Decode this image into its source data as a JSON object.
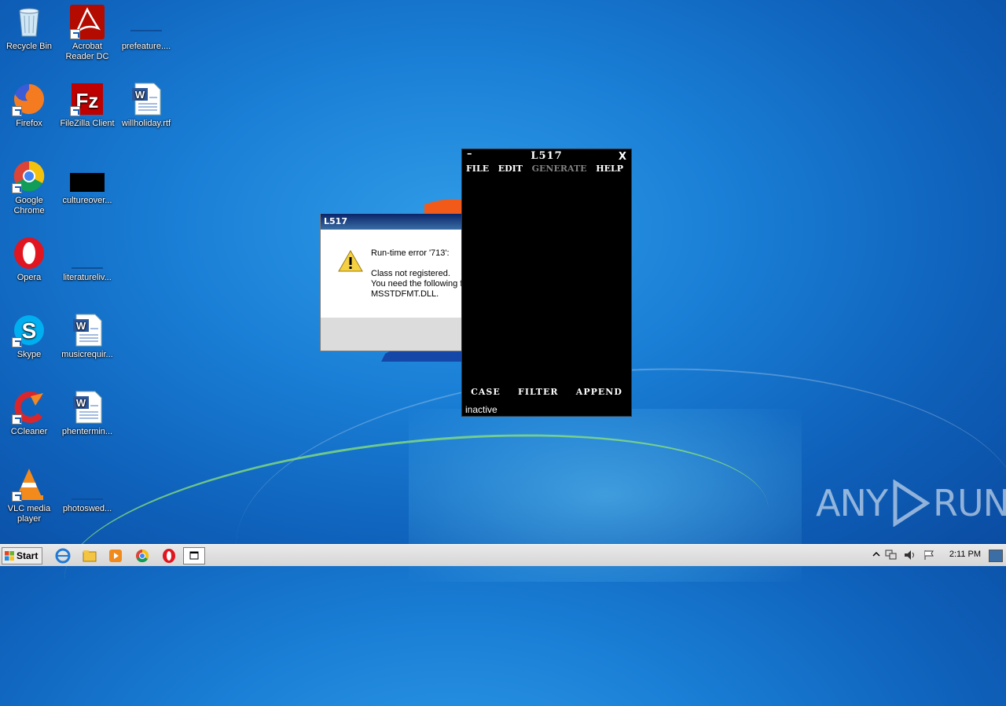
{
  "desktop_icons": [
    {
      "label": "Recycle Bin",
      "icon": "recycle-bin-icon"
    },
    {
      "label": "Acrobat Reader DC",
      "icon": "acrobat-icon"
    },
    {
      "label": "prefeature....",
      "icon": "folder-icon"
    },
    {
      "label": "Firefox",
      "icon": "firefox-icon"
    },
    {
      "label": "FileZilla Client",
      "icon": "filezilla-icon"
    },
    {
      "label": "willholiday.rtf",
      "icon": "word-doc-icon"
    },
    {
      "label": "Google Chrome",
      "icon": "chrome-icon"
    },
    {
      "label": "cultureover...",
      "icon": "black-file-icon"
    },
    {
      "label": "Opera",
      "icon": "opera-icon"
    },
    {
      "label": "literatureliv...",
      "icon": "folder-icon"
    },
    {
      "label": "Skype",
      "icon": "skype-icon"
    },
    {
      "label": "musicrequir...",
      "icon": "word-doc-icon"
    },
    {
      "label": "CCleaner",
      "icon": "ccleaner-icon"
    },
    {
      "label": "phentermin...",
      "icon": "word-doc-icon"
    },
    {
      "label": "VLC media player",
      "icon": "vlc-icon"
    },
    {
      "label": "photoswed...",
      "icon": "folder-icon"
    }
  ],
  "error_dialog": {
    "title": "L517",
    "line1": "Run-time error '713':",
    "line2": "Class not registered.",
    "line3": "You need the following f",
    "line4": "MSSTDFMT.DLL."
  },
  "l517_window": {
    "title": "L517",
    "minimize": "–",
    "close": "X",
    "menu": {
      "file": "FILE",
      "edit": "EDIT",
      "generate": "GENERATE",
      "help": "HELP"
    },
    "buttons": {
      "case": "CASE",
      "filter": "FILTER",
      "append": "APPEND"
    },
    "status": "inactive"
  },
  "watermark": {
    "left": "ANY",
    "right": "RUN"
  },
  "taskbar": {
    "start_label": "Start",
    "clock": "2:11 PM",
    "pinned": [
      "ie-icon",
      "explorer-icon",
      "media-player-icon",
      "chrome-icon",
      "opera-icon",
      "app-window-icon"
    ]
  }
}
